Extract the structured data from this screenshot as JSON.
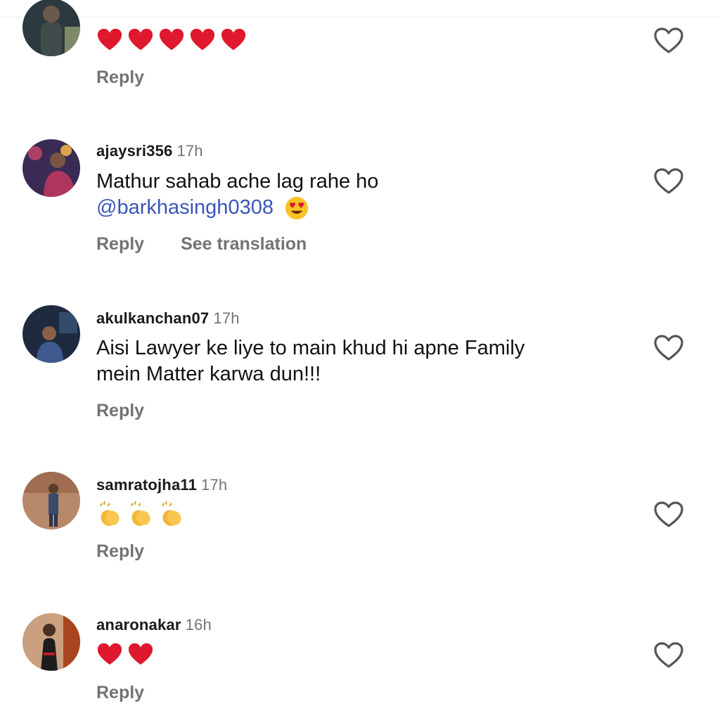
{
  "comments": [
    {
      "username": "",
      "time": "",
      "emoji_text": [
        "red-heart",
        "red-heart",
        "red-heart",
        "red-heart",
        "red-heart"
      ],
      "reply_label": "Reply",
      "avatar_icon": "profile-photo"
    },
    {
      "username": "ajaysri356",
      "time": "17h",
      "text_line1": "Mathur sahab ache lag rahe ho",
      "mention": "@barkhasingh0308",
      "trailing_emoji": "heart-eyes-face",
      "reply_label": "Reply",
      "translate_label": "See translation",
      "avatar_icon": "profile-photo"
    },
    {
      "username": "akulkanchan07",
      "time": "17h",
      "text_line1": "Aisi Lawyer ke liye to main khud hi apne Family",
      "text_line2": "mein Matter karwa dun!!!",
      "reply_label": "Reply",
      "avatar_icon": "profile-photo"
    },
    {
      "username": "samratojha11",
      "time": "17h",
      "emoji_text": [
        "clapping-hands",
        "clapping-hands",
        "clapping-hands"
      ],
      "reply_label": "Reply",
      "avatar_icon": "profile-photo"
    },
    {
      "username": "anaronakar",
      "time": "16h",
      "emoji_text": [
        "red-heart",
        "red-heart"
      ],
      "reply_label": "Reply",
      "avatar_icon": "profile-photo"
    }
  ],
  "like_icon": "heart-outline-icon",
  "colors": {
    "username": "#1a1a1a",
    "secondary": "#737373",
    "mention": "#3b55b8",
    "heart_red": "#e0182d"
  }
}
